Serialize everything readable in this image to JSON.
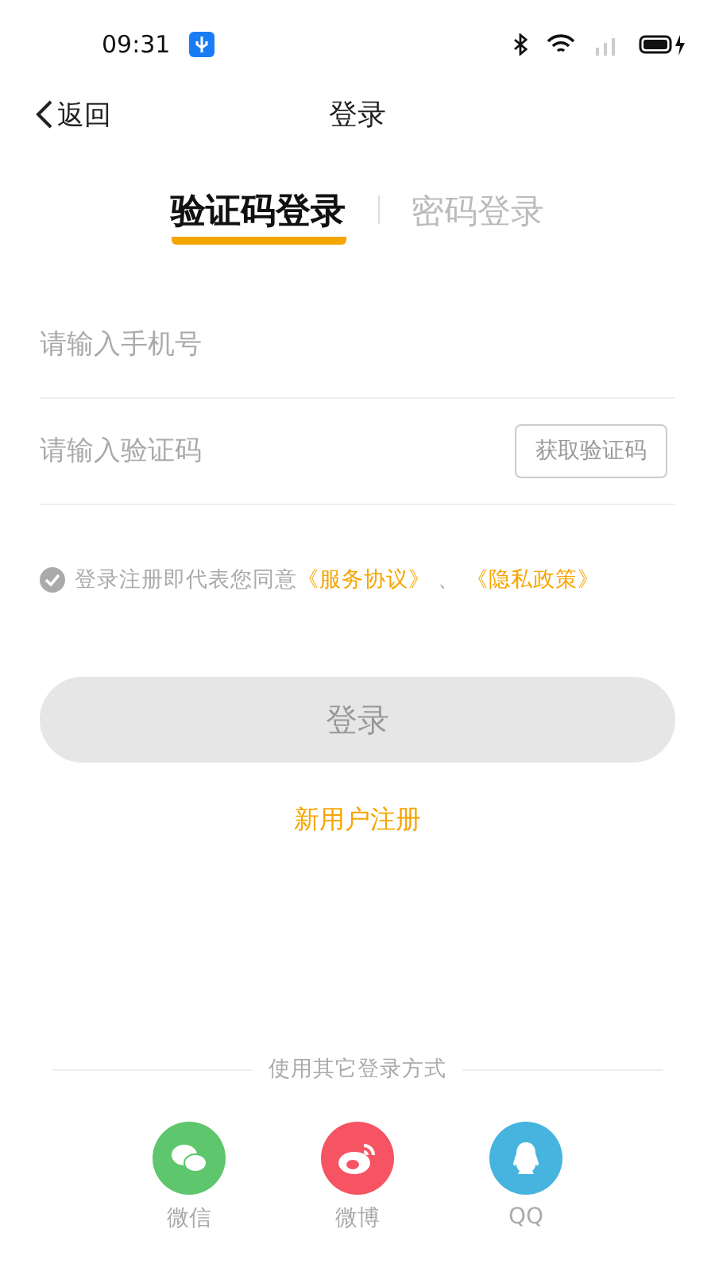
{
  "status_bar": {
    "time": "09:31"
  },
  "nav": {
    "back": "返回",
    "title": "登录"
  },
  "tabs": [
    {
      "label": "验证码登录",
      "selected": true
    },
    {
      "label": "密码登录",
      "selected": false
    }
  ],
  "fields": [
    {
      "placeholder": "请输入手机号"
    },
    {
      "placeholder": "请输入验证码",
      "action": "获取验证码"
    }
  ],
  "agreement": {
    "checked": true,
    "text": "登录注册即代表您同意",
    "links": [
      "《服务协议》",
      "《隐私政策》"
    ],
    "separator": "、"
  },
  "login_button": {
    "label": "登录",
    "disabled": true
  },
  "register_link": "新用户注册",
  "other_login": {
    "title": "使用其它登录方式",
    "options": [
      {
        "kind": "wechat",
        "label": "微信",
        "color": "#5ec66c"
      },
      {
        "kind": "weibo",
        "label": "微博",
        "color": "#f65463"
      },
      {
        "kind": "qq",
        "label": "QQ",
        "color": "#46b4de"
      }
    ]
  }
}
